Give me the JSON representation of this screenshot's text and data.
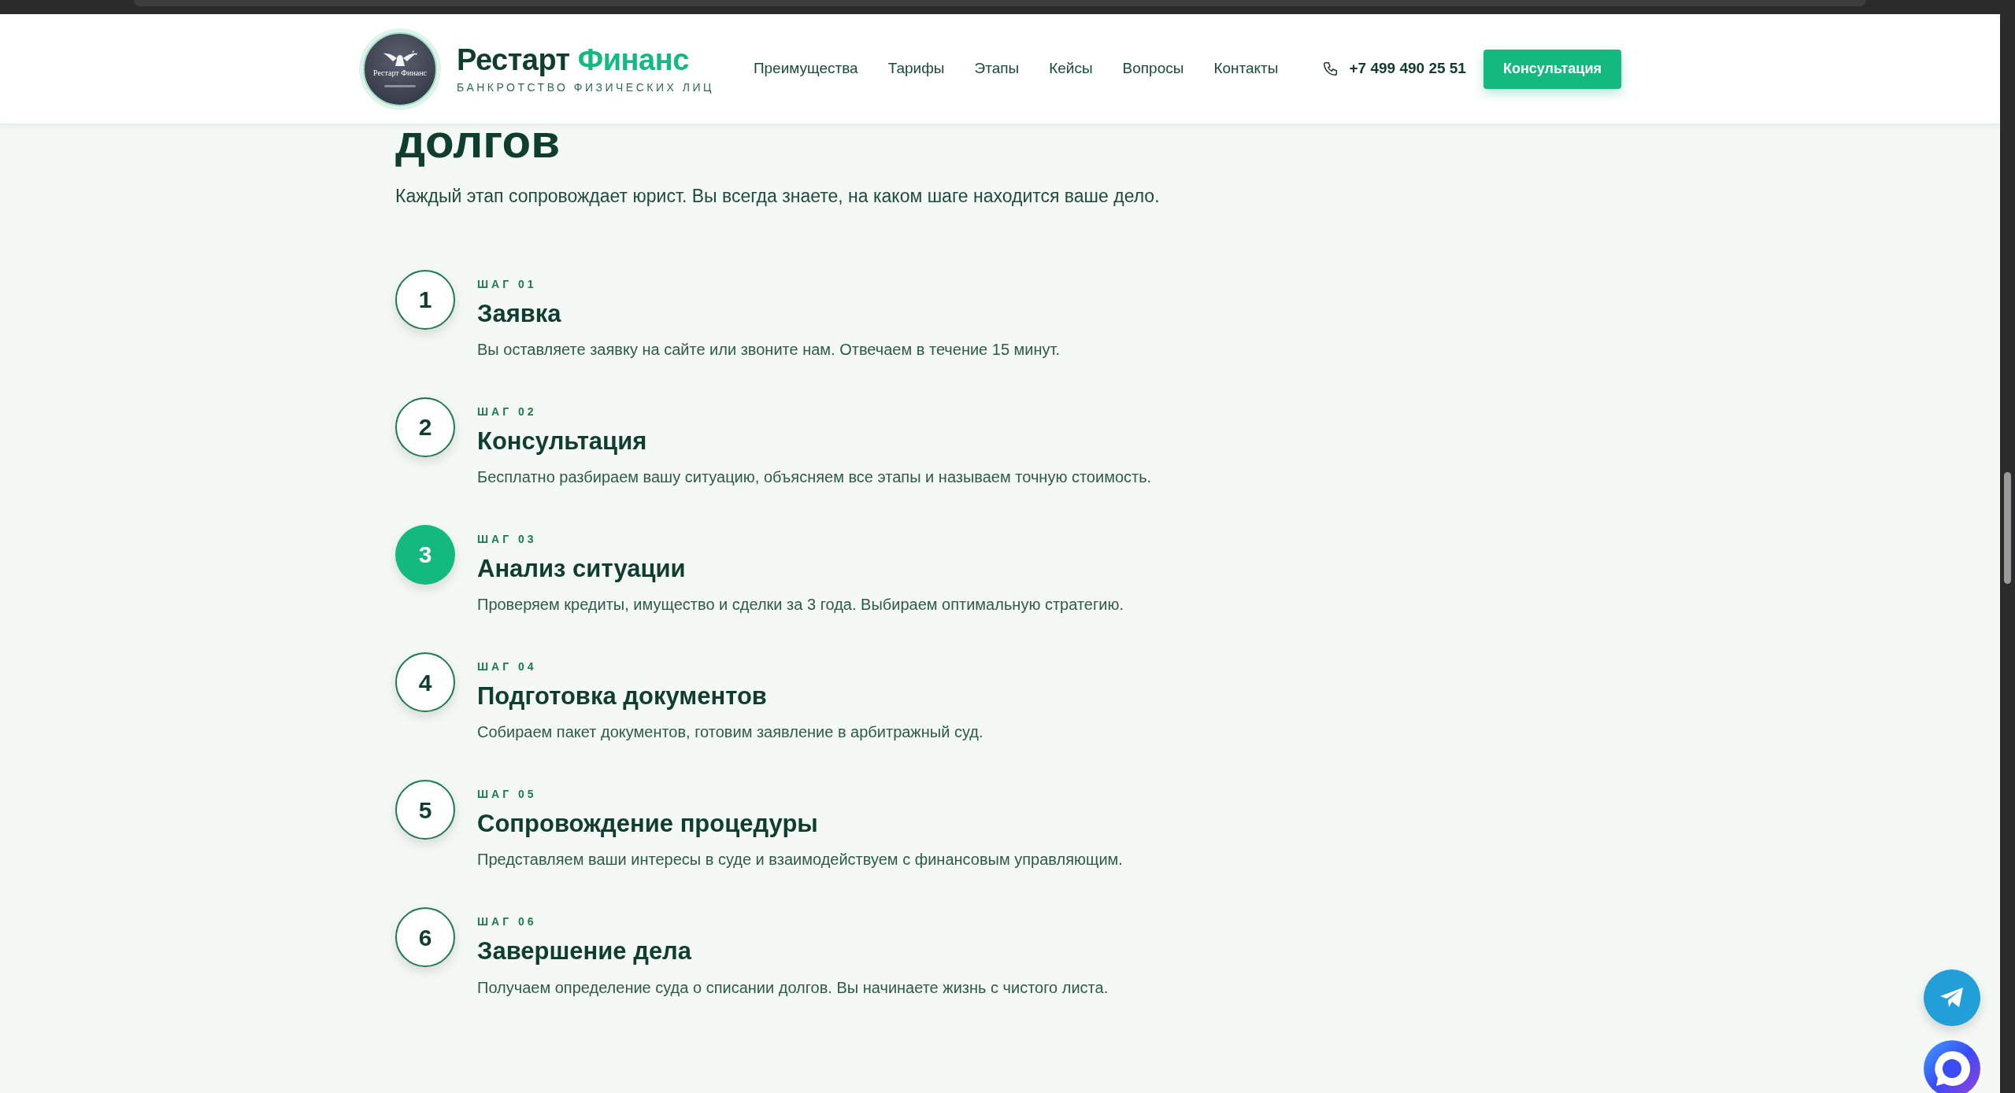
{
  "header": {
    "logo_text": "Рестарт Финанс",
    "brand": {
      "first": "Рестарт",
      "second": "Финанс"
    },
    "tagline": "БАНКРОТСТВО ФИЗИЧЕСКИХ ЛИЦ",
    "nav": [
      "Преимущества",
      "Тарифы",
      "Этапы",
      "Кейсы",
      "Вопросы",
      "Контакты"
    ],
    "phone": "+7 499 490 25 51",
    "cta": "Консультация"
  },
  "section": {
    "heading": "долгов",
    "lead": "Каждый этап сопровождает юрист. Вы всегда знаете, на каком шаге находится ваше дело.",
    "steps": [
      {
        "number": "1",
        "label": "ШАГ 01",
        "title": "Заявка",
        "text": "Вы оставляете заявку на сайте или звоните нам. Отвечаем в течение 15 минут.",
        "current": false
      },
      {
        "number": "2",
        "label": "ШАГ 02",
        "title": "Консультация",
        "text": "Бесплатно разбираем вашу ситуацию, объясняем все этапы и называем точную стоимость.",
        "current": false
      },
      {
        "number": "3",
        "label": "ШАГ 03",
        "title": "Анализ ситуации",
        "text": "Проверяем кредиты, имущество и сделки за 3 года. Выбираем оптимальную стратегию.",
        "current": true
      },
      {
        "number": "4",
        "label": "ШАГ 04",
        "title": "Подготовка документов",
        "text": "Собираем пакет документов, готовим заявление в арбитражный суд.",
        "current": false
      },
      {
        "number": "5",
        "label": "ШАГ 05",
        "title": "Сопровождение процедуры",
        "text": "Представляем ваши интересы в суде и взаимодействуем с финансовым управляющим.",
        "current": false
      },
      {
        "number": "6",
        "label": "ШАГ 06",
        "title": "Завершение дела",
        "text": "Получаем определение суда о списании долгов. Вы начинаете жизнь с чистого листа.",
        "current": false
      }
    ]
  }
}
